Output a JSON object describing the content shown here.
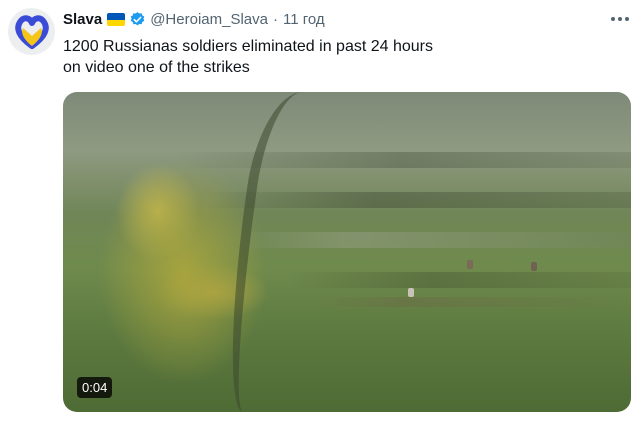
{
  "tweet": {
    "author": {
      "name": "Slava",
      "handle": "@Heroiam_Slava",
      "verified": true,
      "flag": "ukraine-flag",
      "flag_colors": [
        "#0057b7",
        "#ffd700"
      ],
      "avatar_icon": "heart-logo-icon",
      "avatar_colors": [
        "#3a4bd8",
        "#f5c518"
      ]
    },
    "separator": "·",
    "time": "11 год",
    "text_lines": [
      "1200 Russianas soldiers eliminated in past 24 hours",
      "on video one of the strikes"
    ],
    "media": {
      "type": "video",
      "duration": "0:04"
    },
    "more_icon": "more-options-icon"
  },
  "colors": {
    "text_primary": "#0f1419",
    "text_secondary": "#536471",
    "verified_blue": "#1d9bf0"
  }
}
